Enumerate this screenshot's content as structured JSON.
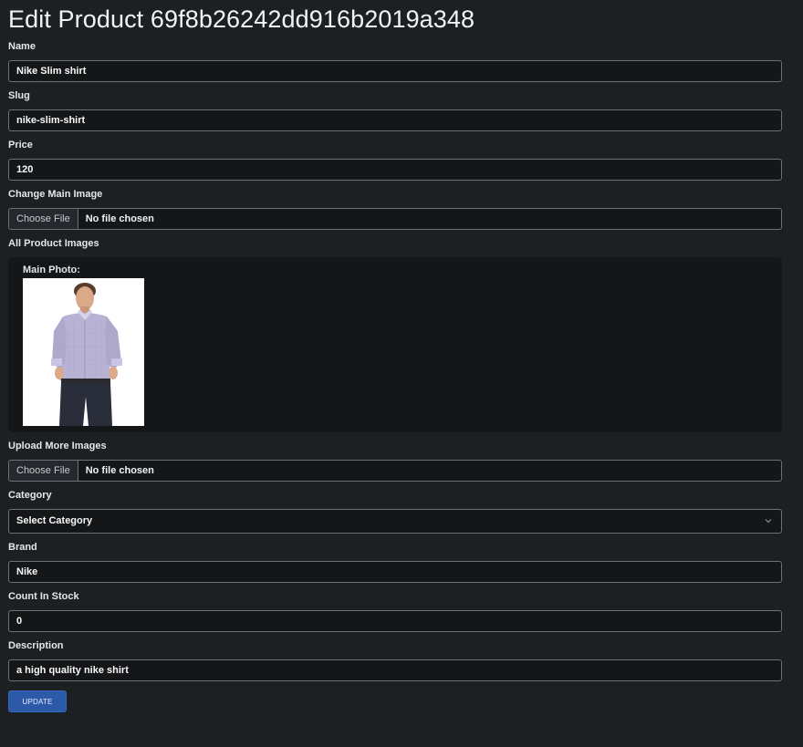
{
  "page": {
    "title": "Edit Product 69f8b26242dd916b2019a348"
  },
  "form": {
    "name": {
      "label": "Name",
      "value": "Nike Slim shirt"
    },
    "slug": {
      "label": "Slug",
      "value": "nike-slim-shirt"
    },
    "price": {
      "label": "Price",
      "value": "120"
    },
    "main_image": {
      "label": "Change Main Image",
      "button": "Choose File",
      "status": "No file chosen"
    },
    "all_images": {
      "label": "All Product Images",
      "main_photo_label": "Main Photo:"
    },
    "more_images": {
      "label": "Upload More Images",
      "button": "Choose File",
      "status": "No file chosen"
    },
    "category": {
      "label": "Category",
      "selected": "Select Category"
    },
    "brand": {
      "label": "Brand",
      "value": "Nike"
    },
    "count": {
      "label": "Count In Stock",
      "value": "0"
    },
    "description": {
      "label": "Description",
      "value": "a high quality nike shirt"
    },
    "submit_label": "UPDATE"
  },
  "colors": {
    "background": "#1d2023",
    "input_bg": "#141618",
    "button_primary": "#2c59a8"
  },
  "icons": {
    "select_arrow": "chevron-down-icon",
    "product_photo": "shirt-model-photo"
  }
}
